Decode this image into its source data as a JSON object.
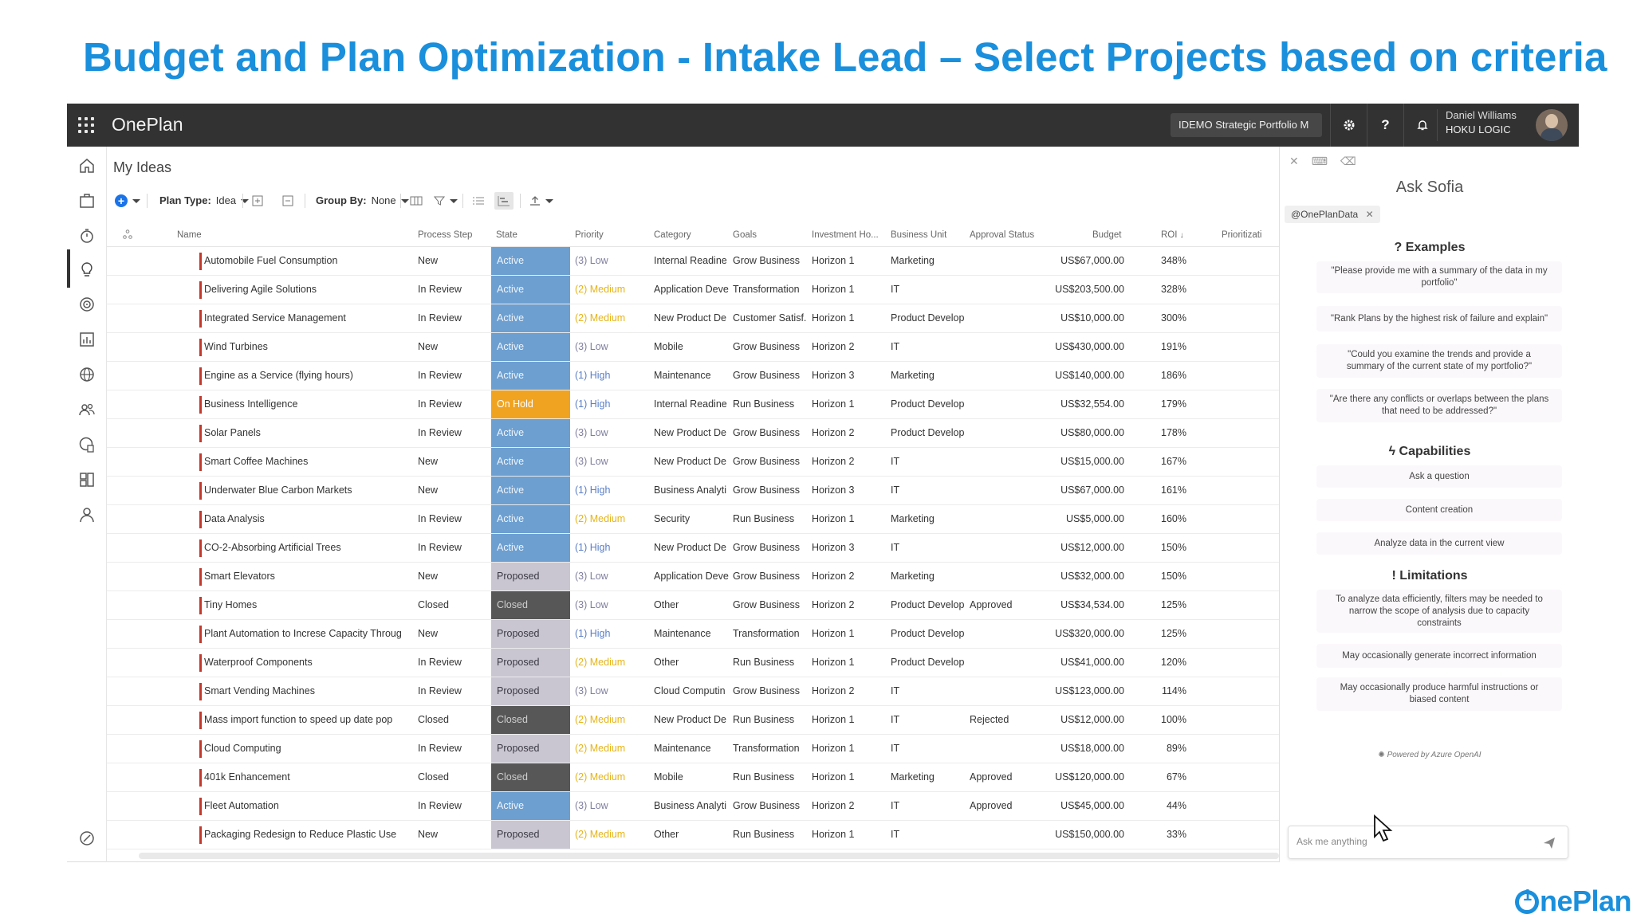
{
  "slide_title": "Budget and Plan Optimization - Intake Lead – Select Projects based on criteria",
  "footer_logo": "nePlan",
  "topbar": {
    "brand": "OnePlan",
    "portfolio": "IDEMO Strategic Portfolio M",
    "help": "?",
    "user_name": "Daniel Williams",
    "user_company": "HOKU LOGIC"
  },
  "page": {
    "title": "My Ideas"
  },
  "toolbar": {
    "plan_type_label": "Plan Type:",
    "plan_type_value": "Idea",
    "group_by_label": "Group By:",
    "group_by_value": "None"
  },
  "grid": {
    "headers": {
      "name": "Name",
      "process_step": "Process Step",
      "state": "State",
      "priority": "Priority",
      "category": "Category",
      "goals": "Goals",
      "investment": "Investment Ho...",
      "business_unit": "Business Unit",
      "approval": "Approval Status",
      "budget": "Budget",
      "roi": "ROI",
      "prioritization": "Prioritizati"
    },
    "rows": [
      {
        "name": "Automobile Fuel Consumption",
        "step": "New",
        "state": "Active",
        "priority": "(3) Low",
        "category": "Internal Readine",
        "goals": "Grow Business",
        "investment": "Horizon 1",
        "unit": "Marketing",
        "approval": "",
        "budget": "US$67,000.00",
        "roi": "348%"
      },
      {
        "name": "Delivering Agile Solutions",
        "step": "In Review",
        "state": "Active",
        "priority": "(2) Medium",
        "category": "Application Deve",
        "goals": "Transformation",
        "investment": "Horizon 1",
        "unit": "IT",
        "approval": "",
        "budget": "US$203,500.00",
        "roi": "328%"
      },
      {
        "name": "Integrated Service Management",
        "step": "In Review",
        "state": "Active",
        "priority": "(2) Medium",
        "category": "New Product De",
        "goals": "Customer Satisf.",
        "investment": "Horizon 1",
        "unit": "Product Develop",
        "approval": "",
        "budget": "US$10,000.00",
        "roi": "300%"
      },
      {
        "name": "Wind Turbines",
        "step": "New",
        "state": "Active",
        "priority": "(3) Low",
        "category": "Mobile",
        "goals": "Grow Business",
        "investment": "Horizon 2",
        "unit": "IT",
        "approval": "",
        "budget": "US$430,000.00",
        "roi": "191%"
      },
      {
        "name": "Engine as a Service (flying hours)",
        "step": "In Review",
        "state": "Active",
        "priority": "(1) High",
        "category": "Maintenance",
        "goals": "Grow Business",
        "investment": "Horizon 3",
        "unit": "Marketing",
        "approval": "",
        "budget": "US$140,000.00",
        "roi": "186%"
      },
      {
        "name": "Business Intelligence",
        "step": "In Review",
        "state": "On Hold",
        "priority": "(1) High",
        "category": "Internal Readine",
        "goals": "Run Business",
        "investment": "Horizon 1",
        "unit": "Product Develop",
        "approval": "",
        "budget": "US$32,554.00",
        "roi": "179%"
      },
      {
        "name": "Solar Panels",
        "step": "In Review",
        "state": "Active",
        "priority": "(3) Low",
        "category": "New Product De",
        "goals": "Grow Business",
        "investment": "Horizon 2",
        "unit": "Product Develop",
        "approval": "",
        "budget": "US$80,000.00",
        "roi": "178%"
      },
      {
        "name": "Smart Coffee Machines",
        "step": "New",
        "state": "Active",
        "priority": "(3) Low",
        "category": "New Product De",
        "goals": "Grow Business",
        "investment": "Horizon 2",
        "unit": "IT",
        "approval": "",
        "budget": "US$15,000.00",
        "roi": "167%"
      },
      {
        "name": "Underwater Blue Carbon Markets",
        "step": "New",
        "state": "Active",
        "priority": "(1) High",
        "category": "Business Analyti",
        "goals": "Grow Business",
        "investment": "Horizon 3",
        "unit": "IT",
        "approval": "",
        "budget": "US$67,000.00",
        "roi": "161%"
      },
      {
        "name": "Data Analysis",
        "step": "In Review",
        "state": "Active",
        "priority": "(2) Medium",
        "category": "Security",
        "goals": "Run Business",
        "investment": "Horizon 1",
        "unit": "Marketing",
        "approval": "",
        "budget": "US$5,000.00",
        "roi": "160%"
      },
      {
        "name": "CO-2-Absorbing Artificial Trees",
        "step": "In Review",
        "state": "Active",
        "priority": "(1) High",
        "category": "New Product De",
        "goals": "Grow Business",
        "investment": "Horizon 3",
        "unit": "IT",
        "approval": "",
        "budget": "US$12,000.00",
        "roi": "150%"
      },
      {
        "name": "Smart Elevators",
        "step": "New",
        "state": "Proposed",
        "priority": "(3) Low",
        "category": "Application Deve",
        "goals": "Grow Business",
        "investment": "Horizon 2",
        "unit": "Marketing",
        "approval": "",
        "budget": "US$32,000.00",
        "roi": "150%"
      },
      {
        "name": "Tiny Homes",
        "step": "Closed",
        "state": "Closed",
        "priority": "(3) Low",
        "category": "Other",
        "goals": "Grow Business",
        "investment": "Horizon 2",
        "unit": "Product Develop",
        "approval": "Approved",
        "budget": "US$34,534.00",
        "roi": "125%"
      },
      {
        "name": "Plant Automation to Increse Capacity Throug",
        "step": "New",
        "state": "Proposed",
        "priority": "(1) High",
        "category": "Maintenance",
        "goals": "Transformation",
        "investment": "Horizon 1",
        "unit": "Product Develop",
        "approval": "",
        "budget": "US$320,000.00",
        "roi": "125%"
      },
      {
        "name": "Waterproof Components",
        "step": "In Review",
        "state": "Proposed",
        "priority": "(2) Medium",
        "category": "Other",
        "goals": "Run Business",
        "investment": "Horizon 1",
        "unit": "Product Develop",
        "approval": "",
        "budget": "US$41,000.00",
        "roi": "120%"
      },
      {
        "name": "Smart Vending Machines",
        "step": "In Review",
        "state": "Proposed",
        "priority": "(3) Low",
        "category": "Cloud Computin",
        "goals": "Grow Business",
        "investment": "Horizon 2",
        "unit": "IT",
        "approval": "",
        "budget": "US$123,000.00",
        "roi": "114%"
      },
      {
        "name": "Mass import function to speed up date pop",
        "step": "Closed",
        "state": "Closed",
        "priority": "(2) Medium",
        "category": "New Product De",
        "goals": "Run Business",
        "investment": "Horizon 1",
        "unit": "IT",
        "approval": "Rejected",
        "budget": "US$12,000.00",
        "roi": "100%"
      },
      {
        "name": "Cloud Computing",
        "step": "In Review",
        "state": "Proposed",
        "priority": "(2) Medium",
        "category": "Maintenance",
        "goals": "Transformation",
        "investment": "Horizon 1",
        "unit": "IT",
        "approval": "",
        "budget": "US$18,000.00",
        "roi": "89%"
      },
      {
        "name": "401k Enhancement",
        "step": "Closed",
        "state": "Closed",
        "priority": "(2) Medium",
        "category": "Mobile",
        "goals": "Run Business",
        "investment": "Horizon 1",
        "unit": "Marketing",
        "approval": "Approved",
        "budget": "US$120,000.00",
        "roi": "67%"
      },
      {
        "name": "Fleet Automation",
        "step": "In Review",
        "state": "Active",
        "priority": "(3) Low",
        "category": "Business Analyti",
        "goals": "Grow Business",
        "investment": "Horizon 2",
        "unit": "IT",
        "approval": "Approved",
        "budget": "US$45,000.00",
        "roi": "44%"
      },
      {
        "name": "Packaging Redesign to Reduce Plastic Use",
        "step": "New",
        "state": "Proposed",
        "priority": "(2) Medium",
        "category": "Other",
        "goals": "Run Business",
        "investment": "Horizon 1",
        "unit": "IT",
        "approval": "",
        "budget": "US$150,000.00",
        "roi": "33%"
      }
    ]
  },
  "sofia": {
    "title": "Ask Sofia",
    "chip": "@OnePlanData",
    "examples_heading": "Examples",
    "examples": [
      "\"Please provide me with a summary of the data in my portfolio\"",
      "\"Rank Plans by the highest risk of failure and explain\"",
      "\"Could you examine the trends and provide a summary of the current state of my portfolio?\"",
      "\"Are there any conflicts or overlaps between the plans that need to be addressed?\""
    ],
    "capabilities_heading": "Capabilities",
    "capabilities": [
      "Ask a question",
      "Content creation",
      "Analyze data in the current view"
    ],
    "limitations_heading": "Limitations",
    "limitations": [
      "To analyze data efficiently, filters may be needed to narrow the scope of analysis due to capacity constraints",
      "May occasionally generate incorrect information",
      "May occasionally produce harmful instructions or biased content"
    ],
    "powered_by": "Powered by Azure OpenAI",
    "ask_placeholder": "Ask me anything"
  }
}
